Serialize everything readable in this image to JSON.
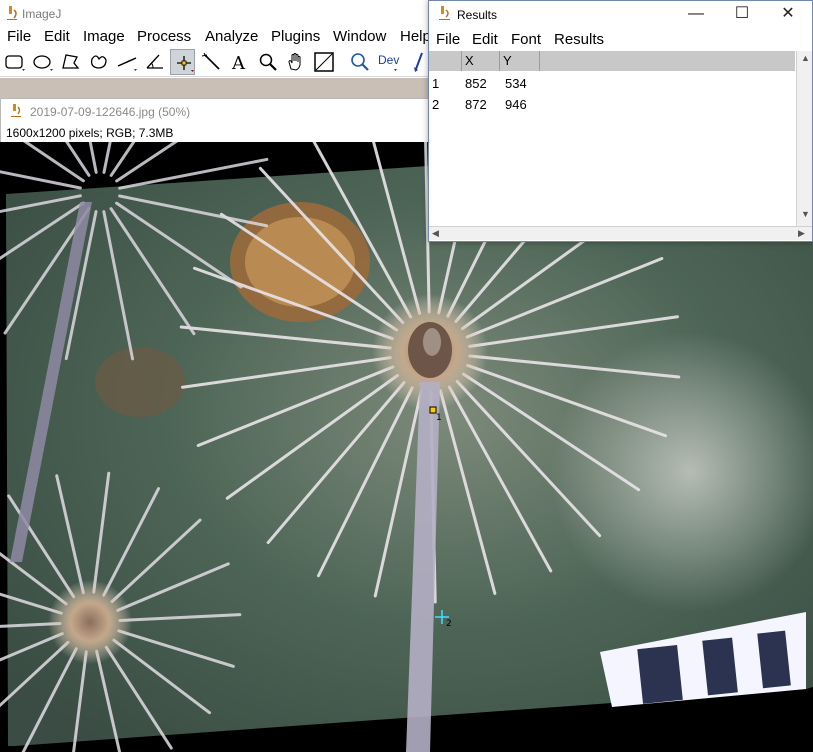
{
  "imagej": {
    "title": "ImageJ",
    "menu": [
      "File",
      "Edit",
      "Image",
      "Process",
      "Analyze",
      "Plugins",
      "Window",
      "Help"
    ],
    "toolbar": {
      "tools": [
        "rectangle-tool-icon",
        "oval-tool-icon",
        "polygon-tool-icon",
        "freehand-tool-icon",
        "line-tool-icon",
        "angle-tool-icon",
        "multipoint-tool-icon",
        "wand-tool-icon",
        "text-tool-icon",
        "magnifier-tool-icon",
        "hand-tool-icon",
        "color-picker-icon",
        "zoom-icon",
        "dev-menu-icon",
        "brush-icon"
      ],
      "dev_label": "Dev",
      "text_tool_label": "A"
    }
  },
  "image_window": {
    "title": "2019-07-09-122646.jpg (50%)",
    "info": "1600x1200 pixels; RGB; 7.3MB",
    "points": [
      {
        "label": "1"
      },
      {
        "label": "2"
      }
    ]
  },
  "results": {
    "title": "Results",
    "menu": [
      "File",
      "Edit",
      "Font",
      "Results"
    ],
    "columns": [
      "",
      "X",
      "Y"
    ],
    "rows": [
      [
        "1",
        "852",
        "534"
      ],
      [
        "2",
        "872",
        "946"
      ]
    ]
  },
  "colors": {
    "results_border": "#6e88b0",
    "header_bg": "#c8c8c8",
    "tool_active": "#cfd4d9",
    "point_marker": "#ffcc00"
  }
}
